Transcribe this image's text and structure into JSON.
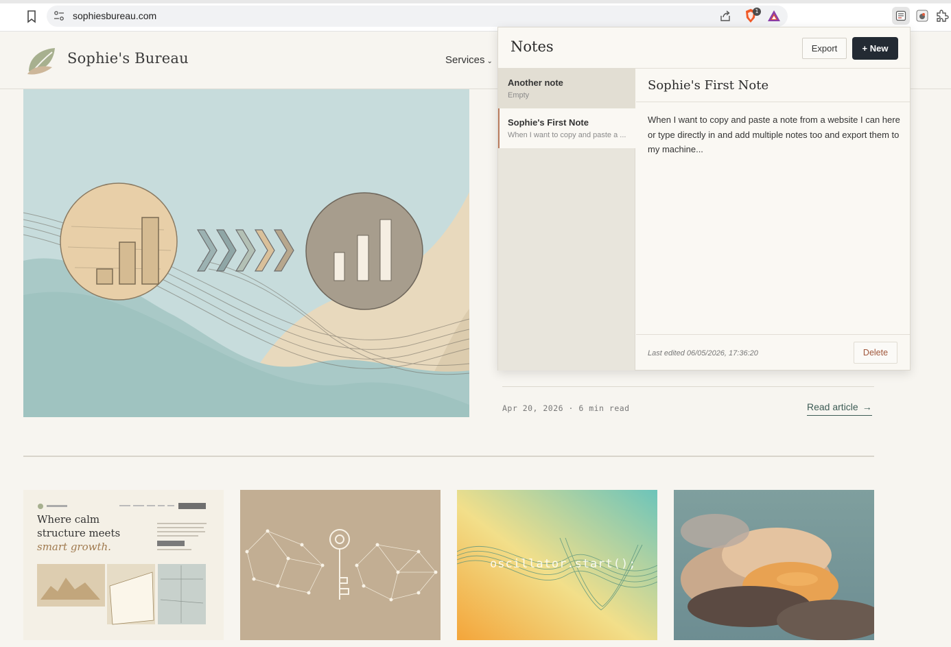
{
  "browser": {
    "url": "sophiesbureau.com",
    "brave_badge_count": "1"
  },
  "site": {
    "brand": "Sophie's Bureau",
    "nav": {
      "services_label": "Services"
    }
  },
  "article": {
    "meta": "Apr 20, 2026 · 6 min read",
    "read_label": "Read article"
  },
  "cards": {
    "card1": {
      "line1": "Where calm",
      "line2": "structure meets",
      "line3": "smart growth."
    },
    "card3": {
      "code": "oscillator.start();"
    }
  },
  "notes_panel": {
    "title": "Notes",
    "export_label": "Export",
    "new_label": "+ New",
    "items": [
      {
        "title": "Another note",
        "preview": "Empty"
      },
      {
        "title": "Sophie's First Note",
        "preview": "When I want to copy and paste a ..."
      }
    ],
    "selected": {
      "title": "Sophie's First Note",
      "body": "When I want to copy and paste a note from a website I can here or type directly in and add multiple notes too and export them to my machine...",
      "last_edited": "Last edited 06/05/2026, 17:36:20",
      "delete_label": "Delete"
    }
  },
  "colors": {
    "accent_dark": "#232a33",
    "link_green": "#3d5b55",
    "delete_red": "#a0563a",
    "selected_note_border": "#b97b5e"
  }
}
